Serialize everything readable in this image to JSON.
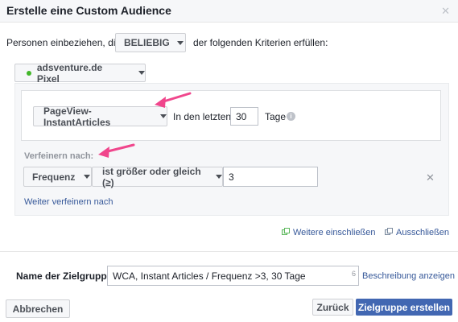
{
  "dialog": {
    "title": "Erstelle eine Custom Audience",
    "close_icon": "close-icon"
  },
  "criteria": {
    "prefix": "Personen einbeziehen, die",
    "match_value": "BELIEBIG",
    "suffix": "der folgenden Kriterien erfüllen:"
  },
  "pixel": {
    "label": "adsventure.de Pixel",
    "status_color": "#42b72a"
  },
  "event_rule": {
    "event": "PageView-InstantArticles",
    "in_last_label": "In den letzten",
    "days_value": "30",
    "days_label": "Tage"
  },
  "refine": {
    "label": "Verfeinern nach:",
    "field": "Frequenz",
    "operator": "ist größer oder gleich (≥)",
    "value": "3",
    "more_link": "Weiter verfeinern nach"
  },
  "actions": {
    "include_more": "Weitere einschließen",
    "exclude": "Ausschließen"
  },
  "audience_name": {
    "label": "Name der Zielgruppe",
    "value": "WCA, Instant Articles / Frequenz >3, 30 Tage",
    "char_count": "6",
    "description_link": "Beschreibung anzeigen"
  },
  "footer": {
    "cancel": "Abbrechen",
    "back": "Zurück",
    "create": "Zielgruppe erstellen"
  },
  "colors": {
    "accent": "#4267b2",
    "link": "#365899",
    "annotation_arrow": "#f0468c"
  }
}
